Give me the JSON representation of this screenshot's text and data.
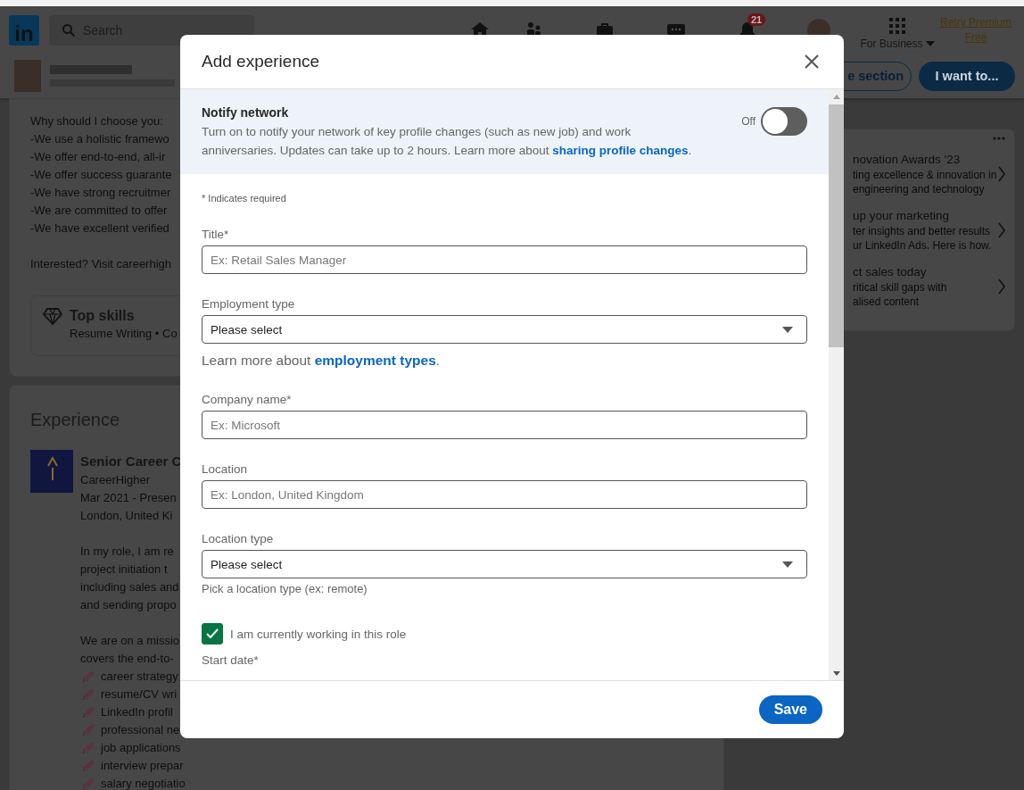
{
  "nav": {
    "logo": "in",
    "search": {
      "placeholder": "Search"
    },
    "notification_badge": "21",
    "business": "For Business",
    "premium": [
      "Retry Premium",
      "Free"
    ]
  },
  "profile_bar": {
    "buttons": [
      {
        "label": "e section",
        "kind": "outline"
      },
      {
        "label": "I want to...",
        "kind": "primary"
      }
    ]
  },
  "about": {
    "lines": [
      "Why should I choose you:",
      "-We use a holistic framewo",
      "-We offer end-to-end, all-ir",
      "-We offer success guarante",
      "-We have strong recruitmer",
      "-We are committed to offer",
      "-We have excellent verified"
    ],
    "closing": "Interested? Visit careerhigh",
    "top_skills": {
      "title": "Top skills",
      "text": "Resume Writing • Co"
    }
  },
  "experience": {
    "title": "Experience",
    "role": "Senior Career C",
    "company": "CareerHigher",
    "dates": "Mar 2021 - Presen",
    "place": "London, United Ki",
    "description": [
      [
        "In my role, I am re",
        "project initiation t",
        "including sales and",
        "and sending propo"
      ],
      [
        "We are on a missio",
        "covers the end-to-"
      ]
    ],
    "bullets": [
      "career strategy",
      "resume/CV wri",
      "LinkedIn profil",
      "professional ne",
      "job applications",
      "interview prepar",
      "salary negotiatio"
    ]
  },
  "promos": [
    {
      "title": "novation Awards '23",
      "text": [
        "ting excellence & innovation in",
        "engineering and technology"
      ]
    },
    {
      "title": "up your marketing",
      "text": [
        "ter insights and better results",
        "ur LinkedIn Ads. Here is how."
      ]
    },
    {
      "title": "ct sales today",
      "text": [
        "ritical skill gaps with",
        "alised content"
      ]
    }
  ],
  "modal": {
    "title": "Add experience",
    "notify": {
      "title": "Notify network",
      "text": "Turn on to notify your network of key profile changes (such as new job) and work anniversaries. Updates can take up to 2 hours. Learn more about **sharing profile changes**.",
      "toggle_label": "Off",
      "on": false
    },
    "required_note": "* Indicates required",
    "fields": [
      {
        "kind": "text",
        "label": "Title*",
        "placeholder": "Ex: Retail Sales Manager"
      },
      {
        "kind": "select",
        "label": "Employment type",
        "value": "Please select",
        "note": "Learn more about **employment types**."
      },
      {
        "kind": "text",
        "label": "Company name*",
        "placeholder": "Ex: Microsoft"
      },
      {
        "kind": "text",
        "label": "Location",
        "placeholder": "Ex: London, United Kingdom"
      },
      {
        "kind": "select",
        "label": "Location type",
        "value": "Please select",
        "hint": "Pick a location type (ex: remote)"
      },
      {
        "kind": "checkbox",
        "label": "I am currently working in this role",
        "checked": true
      },
      {
        "kind": "heading",
        "label": "Start date*"
      }
    ],
    "save": "Save"
  }
}
